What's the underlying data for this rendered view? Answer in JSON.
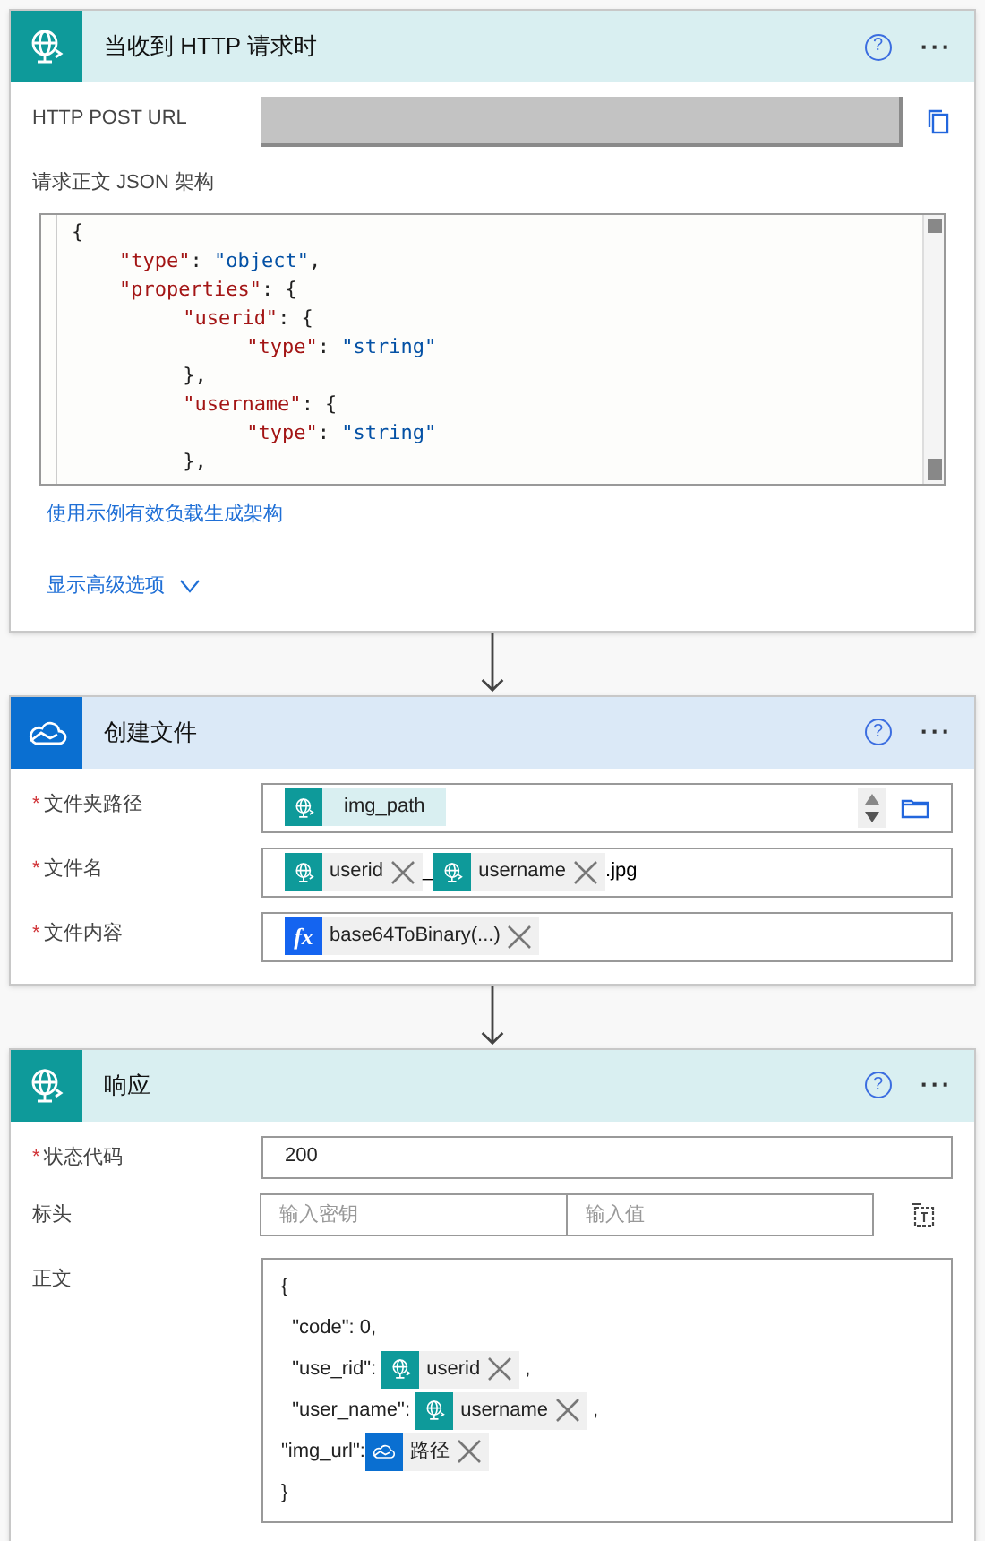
{
  "cards": [
    {
      "kind": "http",
      "title": "当收到 HTTP 请求时",
      "help": "?",
      "more": "···",
      "rows": [
        {
          "kind": "url",
          "label": "HTTP POST URL"
        },
        {
          "kind": "code",
          "label": "请求正文 JSON 架构",
          "lines": [
            {
              "tokens": [
                {
                  "kind": "punct",
                  "text": "{"
                }
              ],
              "children": [
                {
                  "tokens": [
                    {
                      "kind": "key",
                      "text": "\"type\""
                    },
                    {
                      "kind": "punct",
                      "text": ": "
                    },
                    {
                      "kind": "string",
                      "text": "\"object\""
                    },
                    {
                      "kind": "punct",
                      "text": ","
                    }
                  ]
                },
                {
                  "tokens": [
                    {
                      "kind": "key",
                      "text": "\"properties\""
                    },
                    {
                      "kind": "punct",
                      "text": ": {"
                    }
                  ],
                  "children": [
                    {
                      "tokens": [
                        {
                          "kind": "key",
                          "text": "\"userid\""
                        },
                        {
                          "kind": "punct",
                          "text": ": {"
                        }
                      ],
                      "children": [
                        {
                          "tokens": [
                            {
                              "kind": "key",
                              "text": "\"type\""
                            },
                            {
                              "kind": "punct",
                              "text": ": "
                            },
                            {
                              "kind": "string",
                              "text": "\"string\""
                            }
                          ]
                        }
                      ]
                    },
                    {
                      "tokens": [
                        {
                          "kind": "punct",
                          "text": "},"
                        }
                      ]
                    },
                    {
                      "tokens": [
                        {
                          "kind": "key",
                          "text": "\"username\""
                        },
                        {
                          "kind": "punct",
                          "text": ": {"
                        }
                      ],
                      "children": [
                        {
                          "tokens": [
                            {
                              "kind": "key",
                              "text": "\"type\""
                            },
                            {
                              "kind": "punct",
                              "text": ": "
                            },
                            {
                              "kind": "string",
                              "text": "\"string\""
                            }
                          ]
                        }
                      ]
                    },
                    {
                      "tokens": [
                        {
                          "kind": "punct",
                          "text": "},"
                        }
                      ]
                    }
                  ]
                }
              ]
            }
          ]
        }
      ],
      "links": [
        {
          "kind": "link",
          "text": "使用示例有效负载生成架构"
        },
        {
          "kind": "expander",
          "text": "显示高级选项",
          "expanded": false
        }
      ]
    },
    {
      "kind": "onedrive",
      "title": "创建文件",
      "help": "?",
      "more": "···",
      "rows": [
        {
          "kind": "tokens",
          "label": "文件夹路径",
          "required_mark": "*",
          "picker": true,
          "tokens": [
            {
              "kind": "http",
              "text": "img_path",
              "removable": false
            }
          ]
        },
        {
          "kind": "tokens",
          "label": "文件名",
          "required_mark": "*",
          "picker": false,
          "tokens": [
            {
              "kind": "http",
              "text": "userid",
              "removable": true
            },
            {
              "kind": "text",
              "text": "_"
            },
            {
              "kind": "http",
              "text": "username",
              "removable": true
            },
            {
              "kind": "text",
              "text": ".jpg"
            }
          ]
        },
        {
          "kind": "tokens",
          "label": "文件内容",
          "required_mark": "*",
          "picker": false,
          "tokens": [
            {
              "kind": "function",
              "icon": "fx",
              "text": "base64ToBinary(...)",
              "removable": true
            }
          ]
        }
      ]
    },
    {
      "kind": "http",
      "title": "响应",
      "help": "?",
      "more": "···",
      "rows": [
        {
          "kind": "text",
          "label": "状态代码",
          "required_mark": "*",
          "value": "200"
        },
        {
          "kind": "pair",
          "label": "标头",
          "placeholders": [
            "输入密钥",
            "输入值"
          ]
        },
        {
          "kind": "body",
          "label": "正文",
          "lines": [
            [
              {
                "kind": "text",
                "text": "{"
              }
            ],
            [
              {
                "kind": "text",
                "text": "  \"code\": 0,"
              }
            ],
            [
              {
                "kind": "text",
                "text": "  \"use_rid\": "
              },
              {
                "kind": "http",
                "text": "userid",
                "removable": true
              },
              {
                "kind": "text",
                "text": " ,"
              }
            ],
            [
              {
                "kind": "text",
                "text": "  \"user_name\": "
              },
              {
                "kind": "http",
                "text": "username",
                "removable": true
              },
              {
                "kind": "text",
                "text": " ,"
              }
            ],
            [
              {
                "kind": "text",
                "text": "\"img_url\":"
              },
              {
                "kind": "onedrive",
                "text": "路径",
                "removable": true
              }
            ],
            [
              {
                "kind": "text",
                "text": "}"
              }
            ]
          ]
        }
      ]
    }
  ]
}
